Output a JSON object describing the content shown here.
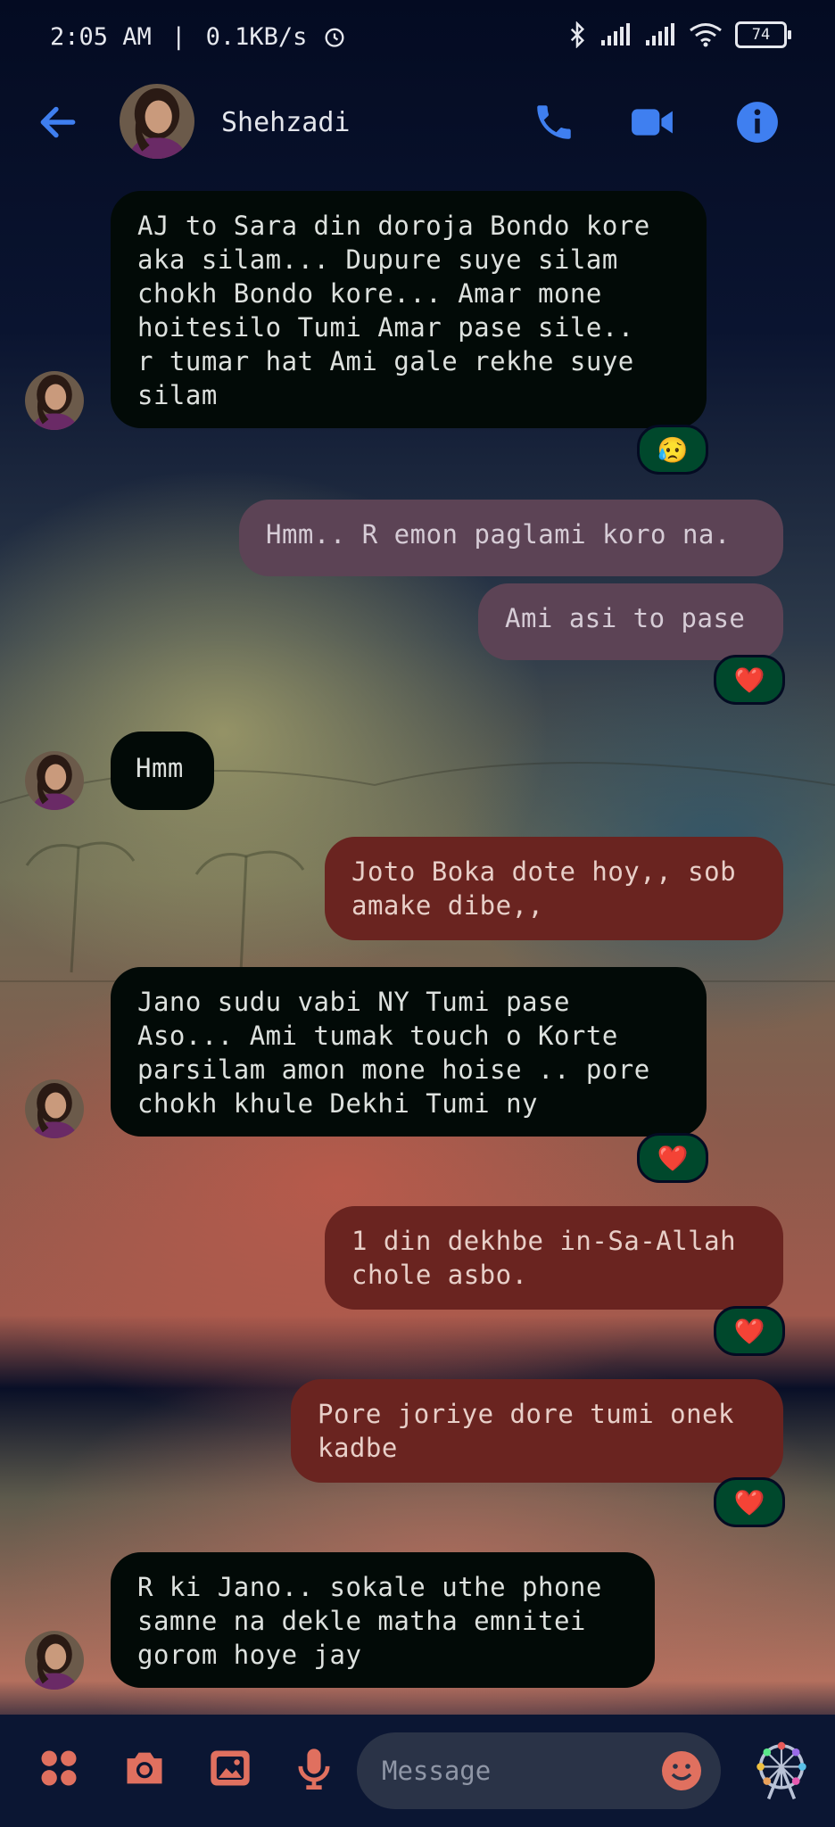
{
  "status_bar": {
    "time": "2:05 AM",
    "divider": "|",
    "speed": "0.1KB/s",
    "battery": "74"
  },
  "header": {
    "contact_name": "Shehzadi"
  },
  "messages": [
    {
      "side": "in",
      "text": "AJ to Sara din doroja Bondo kore\naka silam... Dupure suye silam\nchokh Bondo kore... Amar mone\nhoitesilo Tumi Amar pase sile..\nr tumar hat Ami gale rekhe suye\nsilam",
      "reaction": "😥"
    },
    {
      "side": "out",
      "text": "Hmm.. R emon paglami koro na."
    },
    {
      "side": "out",
      "text": "Ami asi to pase",
      "reaction": "❤️"
    },
    {
      "side": "in",
      "text": "Hmm"
    },
    {
      "side": "out",
      "text": "Joto Boka dote hoy,, sob\namake dibe,,"
    },
    {
      "side": "in",
      "text": "Jano sudu vabi NY Tumi pase\nAso... Ami tumak touch o Korte\nparsilam amon mone hoise .. pore\nchokh khule Dekhi Tumi ny",
      "reaction": "❤️"
    },
    {
      "side": "out",
      "text": "1 din dekhbe in-Sa-Allah\nchole asbo.",
      "reaction": "❤️"
    },
    {
      "side": "out",
      "text": "Pore joriye dore tumi onek\nkadbe",
      "reaction": "❤️"
    },
    {
      "side": "in",
      "text": "R ki Jano.. sokale uthe phone\nsamne na dekle matha emnitei\ngorom hoye jay"
    }
  ],
  "composer": {
    "placeholder": "Message"
  },
  "colors": {
    "accent": "#3f7ff0",
    "composer_icon": "#e0705f",
    "incoming_bubble": "#020a07",
    "outgoing_bubble_gray": "#5c4355",
    "outgoing_bubble_red": "#6a2420",
    "reaction_pill": "#00482c"
  }
}
